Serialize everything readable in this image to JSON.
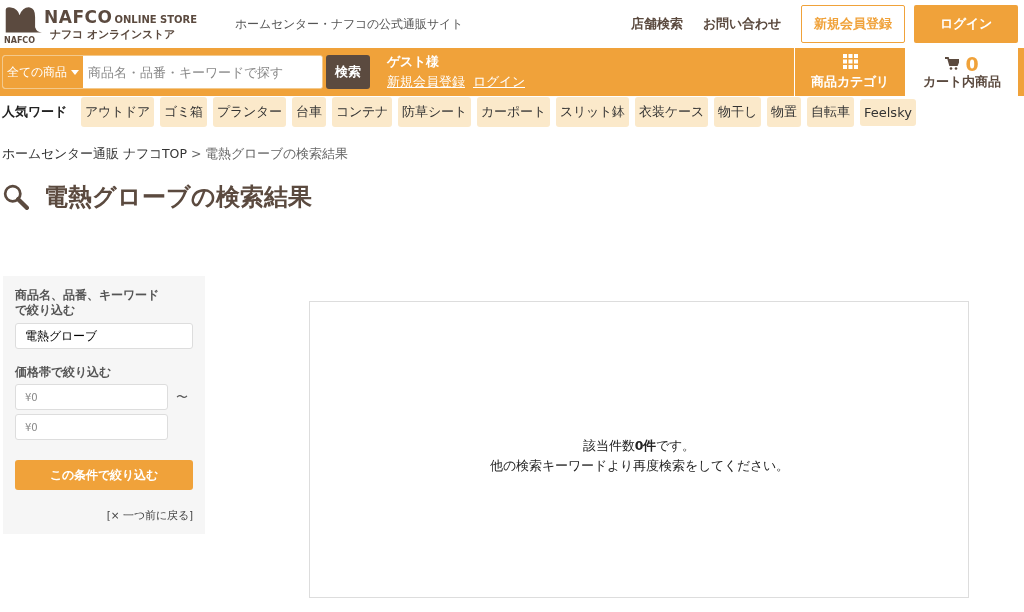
{
  "header": {
    "logo_main": "NAFCO",
    "logo_sub": "ONLINE STORE",
    "logo_kana": "ナフコ オンラインストア",
    "logo_mark": "NAFCO",
    "tagline": "ホームセンター・ナフコの公式通販サイト",
    "links": [
      "店舗検索",
      "お問い合わせ"
    ],
    "register_button": "新規会員登録",
    "login_button": "ログイン"
  },
  "search_bar": {
    "scope": "全ての商品",
    "placeholder": "商品名・品番・キーワードで探す",
    "button": "検索",
    "guest": "ゲスト様",
    "register_link": "新規会員登録",
    "login_link": "ログイン",
    "category_label": "商品カテゴリ",
    "cart_count": "0",
    "cart_label": "カート内商品"
  },
  "popular": {
    "label": "人気ワード",
    "tags": [
      "アウトドア",
      "ゴミ箱",
      "プランター",
      "台車",
      "コンテナ",
      "防草シート",
      "カーポート",
      "スリット鉢",
      "衣装ケース",
      "物干し",
      "物置",
      "自転車",
      "Feelsky"
    ]
  },
  "breadcrumb": {
    "home": "ホームセンター通販 ナフコTOP",
    "separator": ">",
    "current": "電熱グローブの検索結果"
  },
  "page_title": "電熱グローブの検索結果",
  "filter": {
    "keyword_label": [
      "商品名、品番、キーワード",
      "で絞り込む"
    ],
    "keyword_value": "電熱グローブ",
    "price_label": "価格帯で絞り込む",
    "price_min_placeholder": "¥0",
    "range_sign": "〜",
    "price_max_placeholder": "¥0",
    "apply_button": "この条件で絞り込む",
    "back_link": "[× 一つ前に戻る]"
  },
  "results": {
    "count_line": "該当件数**0件**です。",
    "hint": "他の検索キーワードより再度検索をしてください。"
  }
}
